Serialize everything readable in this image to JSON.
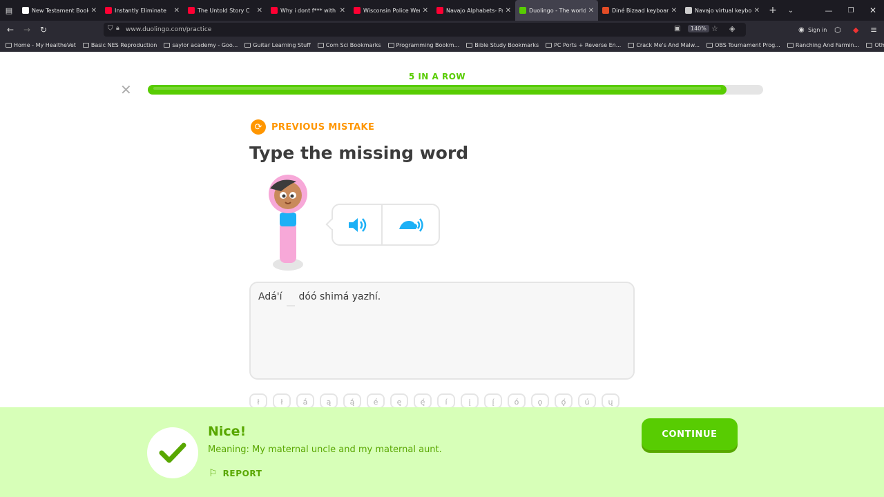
{
  "tabs": [
    {
      "label": "New Testament Books",
      "color": "#fff"
    },
    {
      "label": "Instantly Eliminate",
      "color": "#ff0033"
    },
    {
      "label": "The Untold Story C",
      "color": "#ff0033"
    },
    {
      "label": "Why i dont f*** with ou",
      "color": "#ff0033"
    },
    {
      "label": "Wisconsin Police Were",
      "color": "#ff0033"
    },
    {
      "label": "Navajo Alphabets- Pari",
      "color": "#ff0033"
    },
    {
      "label": "Duolingo - The world's",
      "color": "#58cc02"
    },
    {
      "label": "Diné Bizaad keyboard",
      "color": "#e34c26"
    },
    {
      "label": "Navajo virtual keyboar",
      "color": "#ccc"
    }
  ],
  "browser": {
    "url": "www.duolingo.com/practice",
    "zoom": "140%",
    "sign_in": "Sign in"
  },
  "bookmarks": [
    "Home - My HealtheVet",
    "Basic NES Reproduction",
    "saylor academy - Goo...",
    "Guitar Learning Stuff",
    "Com Sci Bookmarks",
    "Programming Bookm...",
    "Bible Study Bookmarks",
    "PC Ports + Reverse En...",
    "Crack Me's And Malw...",
    "OBS Tournament Prog...",
    "Ranching And Farmin...",
    "Other Bookmarks"
  ],
  "lesson": {
    "streak": "5 IN A ROW",
    "progress": 0.94,
    "tag": "PREVIOUS MISTAKE",
    "title": "Type the missing word"
  },
  "sentence": {
    "before": "Adá'í",
    "after": "dóó shimá yazhí."
  },
  "keys": [
    "ł",
    "ł",
    "á",
    "ą",
    "ą́",
    "é",
    "ę",
    "ę́",
    "í",
    "į",
    "į́",
    "ó",
    "ǫ",
    "ǫ́",
    "ú",
    "ų"
  ],
  "feedback": {
    "title": "Nice!",
    "meaning": "Meaning: My maternal uncle and my maternal aunt.",
    "report": "REPORT",
    "continue": "CONTINUE"
  },
  "colors": {
    "green": "#58cc02",
    "feedback_bg": "#d7ffb8",
    "feedback_text": "#58a700",
    "orange": "#ff9600",
    "blue": "#1cb0f6"
  }
}
